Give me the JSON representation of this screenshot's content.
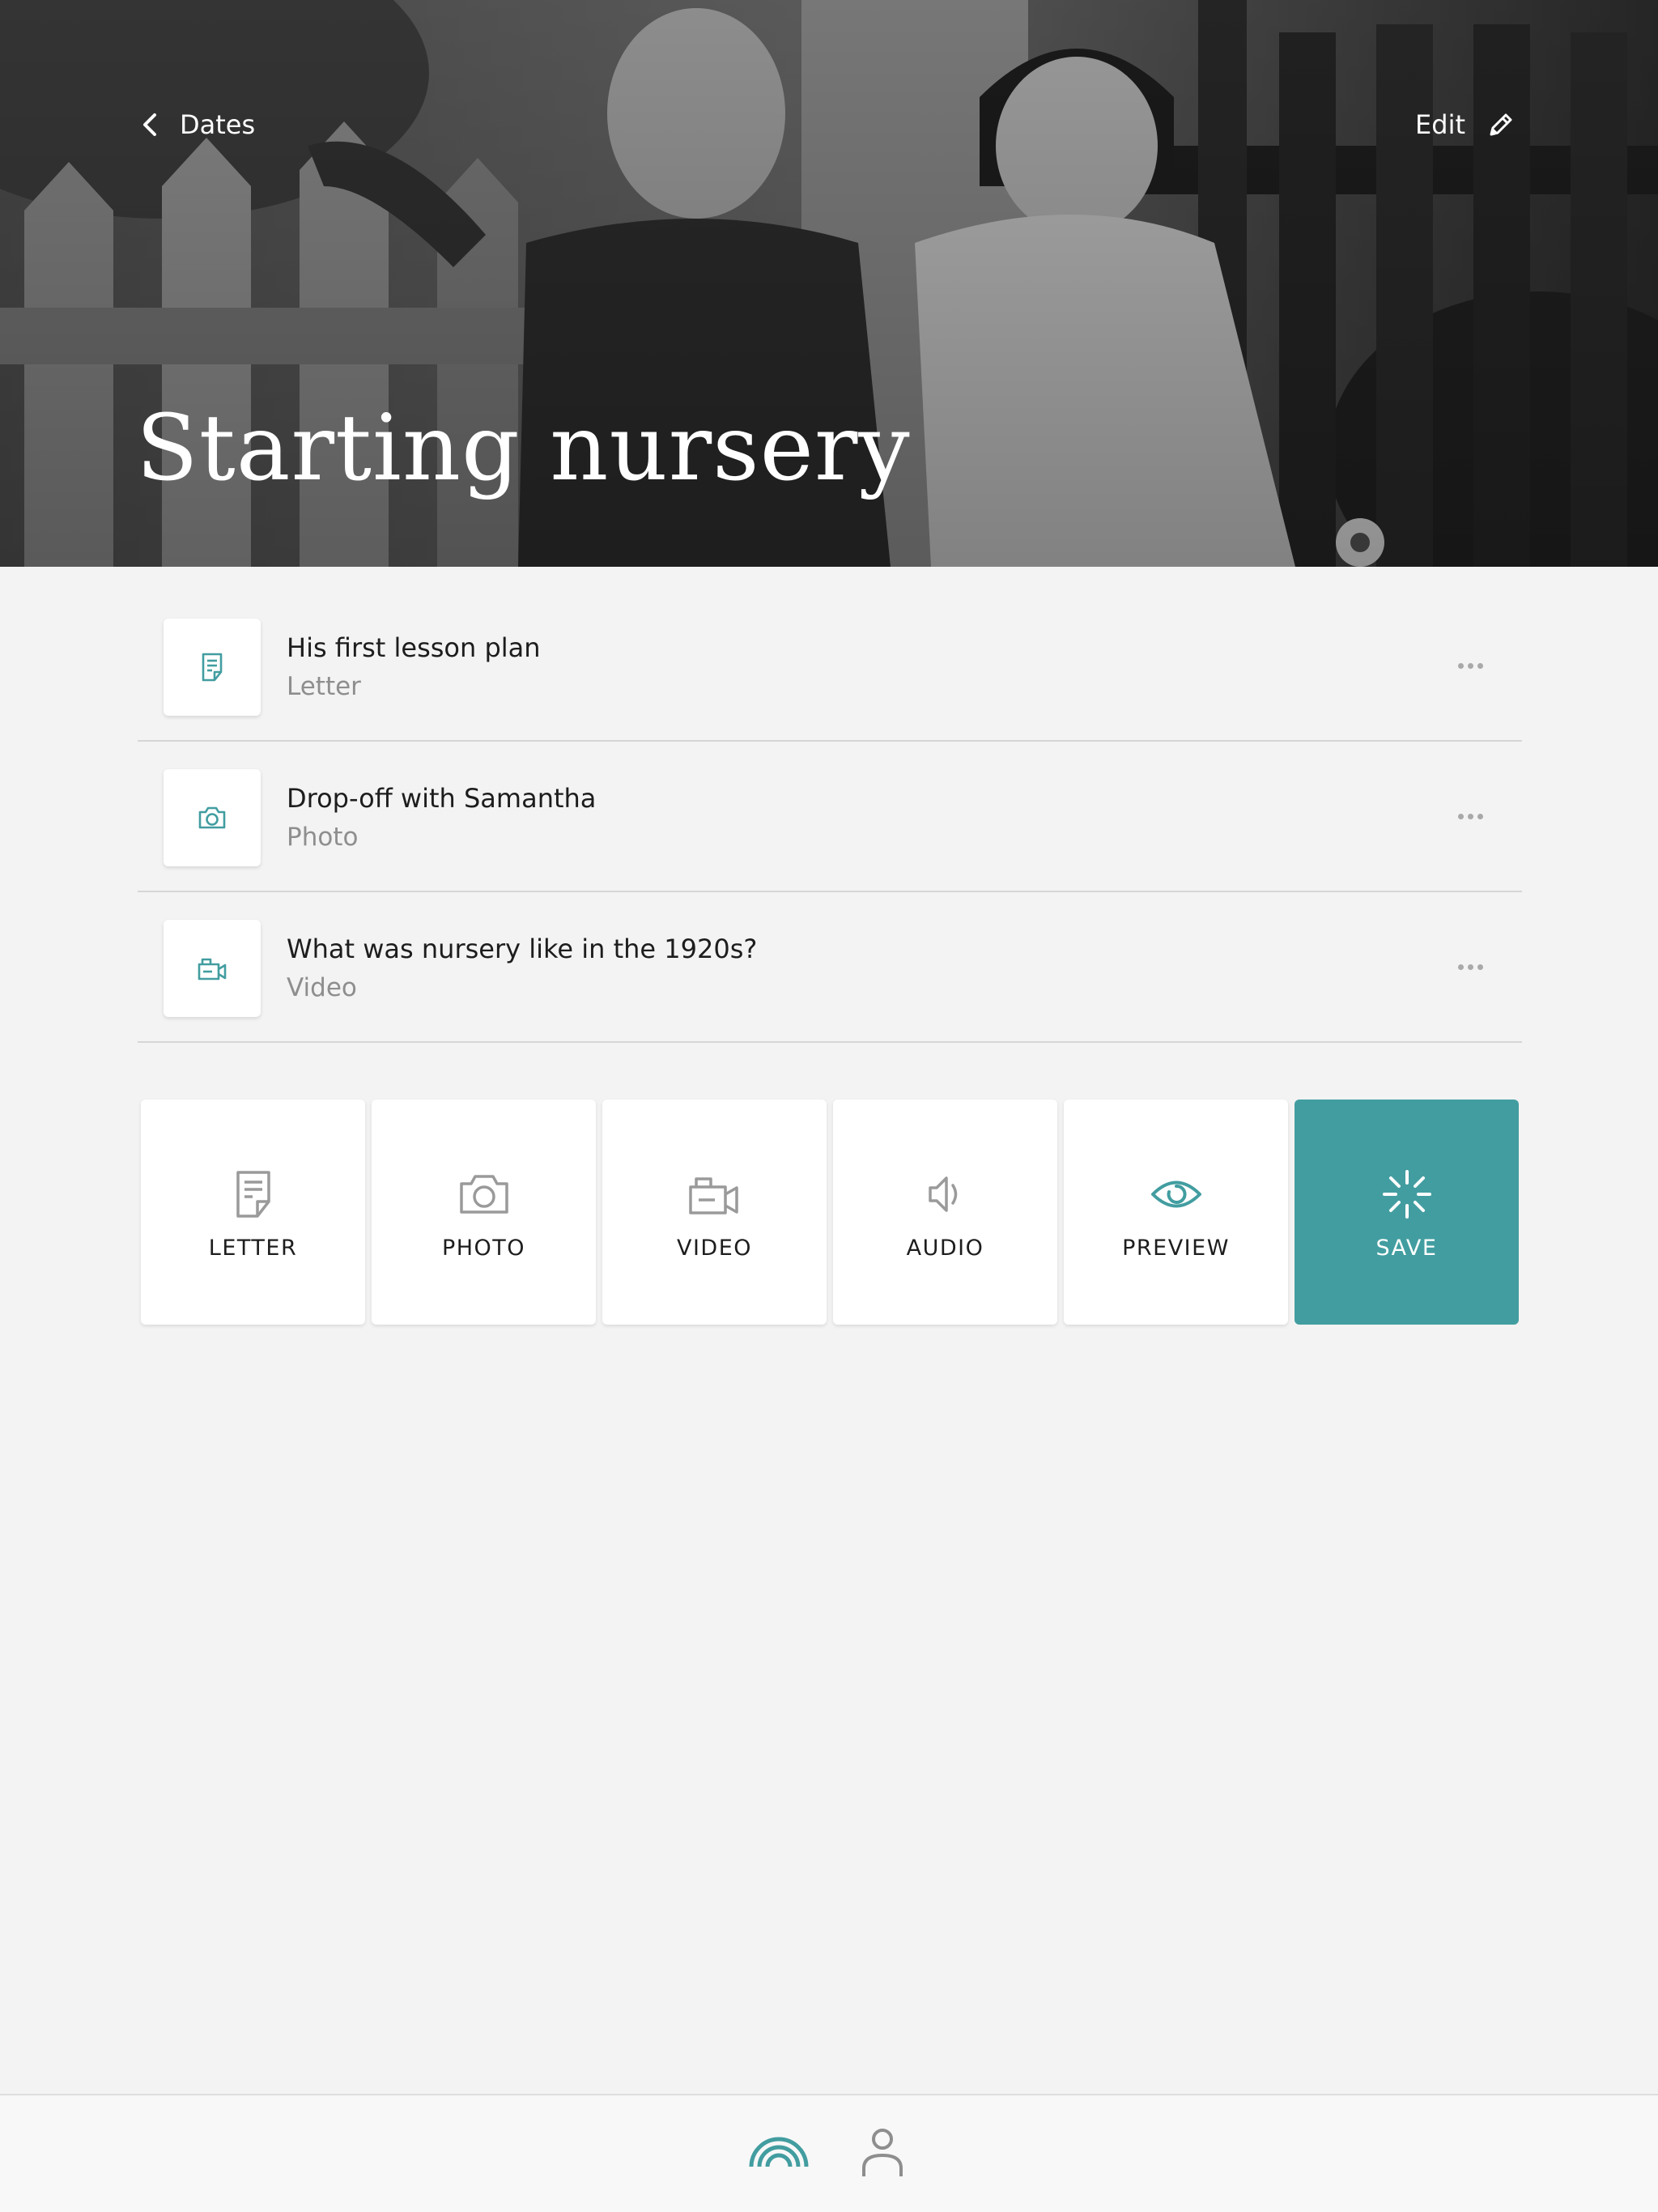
{
  "header": {
    "back_label": "Dates",
    "edit_label": "Edit",
    "title": "Starting nursery"
  },
  "items": [
    {
      "title": "His first lesson plan",
      "type": "Letter",
      "icon": "letter-icon"
    },
    {
      "title": "Drop-off with Samantha",
      "type": "Photo",
      "icon": "camera-icon"
    },
    {
      "title": "What was nursery like in the 1920s?",
      "type": "Video",
      "icon": "video-camera-icon"
    }
  ],
  "actions": {
    "letter": "LETTER",
    "photo": "PHOTO",
    "video": "VIDEO",
    "audio": "AUDIO",
    "preview": "PREVIEW",
    "save": "SAVE"
  },
  "bottom_nav": {
    "home_icon": "rainbow-icon",
    "profile_icon": "person-icon"
  },
  "colors": {
    "accent": "#429da0",
    "background": "#f3f3f3",
    "tile_icon_gray": "#9a9a9a"
  }
}
